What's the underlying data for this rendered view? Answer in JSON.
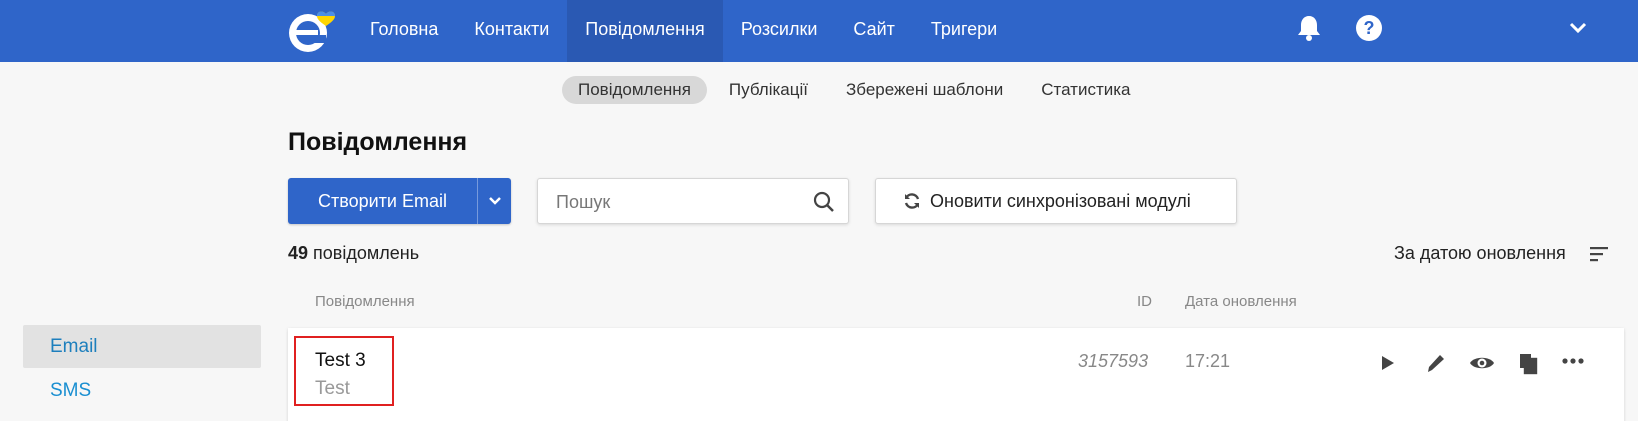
{
  "colors": {
    "brand_blue": "#2f65c9",
    "link_blue": "#1a8fd1",
    "highlight_red": "#e02020"
  },
  "nav": {
    "items": [
      {
        "label": "Головна",
        "active": false
      },
      {
        "label": "Контакти",
        "active": false
      },
      {
        "label": "Повідомлення",
        "active": true
      },
      {
        "label": "Розсилки",
        "active": false
      },
      {
        "label": "Сайт",
        "active": false
      },
      {
        "label": "Тригери",
        "active": false
      }
    ],
    "icons": [
      "bell-icon",
      "help-icon",
      "chevron-down-icon"
    ]
  },
  "subtabs": [
    {
      "label": "Повідомлення",
      "active": true
    },
    {
      "label": "Публікації",
      "active": false
    },
    {
      "label": "Збережені шаблони",
      "active": false
    },
    {
      "label": "Статистика",
      "active": false
    }
  ],
  "page_title": "Повідомлення",
  "toolbar": {
    "create_label": "Створити Email",
    "search_placeholder": "Пошук",
    "sync_label": "Оновити синхронізовані модулі"
  },
  "summary": {
    "count": "49",
    "count_suffix": "повідомлень",
    "sort_label": "За датою оновлення"
  },
  "table": {
    "headers": {
      "message": "Повідомлення",
      "id": "ID",
      "date": "Дата оновлення"
    },
    "rows": [
      {
        "title": "Test 3",
        "subtitle": "Test",
        "id": "3157593",
        "date": "17:21",
        "actions": [
          "play-icon",
          "pencil-icon",
          "eye-icon",
          "copy-icon",
          "more-icon"
        ]
      }
    ]
  },
  "sidebar": {
    "items": [
      {
        "label": "Email",
        "active": true
      },
      {
        "label": "SMS",
        "active": false
      }
    ]
  }
}
